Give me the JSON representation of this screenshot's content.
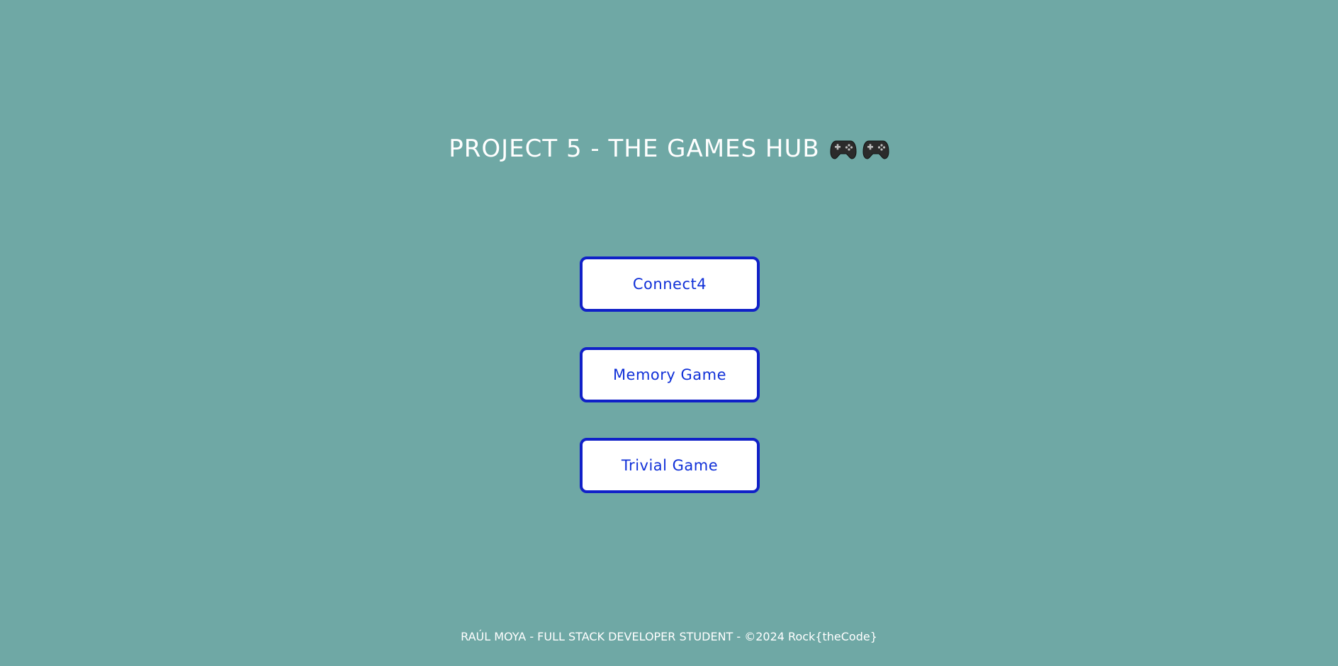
{
  "header": {
    "title": "PROJECT 5 - THE GAMES HUB",
    "icons": [
      "gamepad-icon",
      "gamepad-icon"
    ]
  },
  "menu": {
    "buttons": [
      {
        "label": "Connect4"
      },
      {
        "label": "Memory Game"
      },
      {
        "label": "Trivial Game"
      }
    ]
  },
  "footer": {
    "text": "RAÚL MOYA - FULL STACK DEVELOPER STUDENT - ©2024 Rock{theCode}"
  },
  "colors": {
    "background": "#6fa8a5",
    "button_border": "#1020c8",
    "button_text": "#1030d8",
    "title_text": "#ffffff"
  }
}
